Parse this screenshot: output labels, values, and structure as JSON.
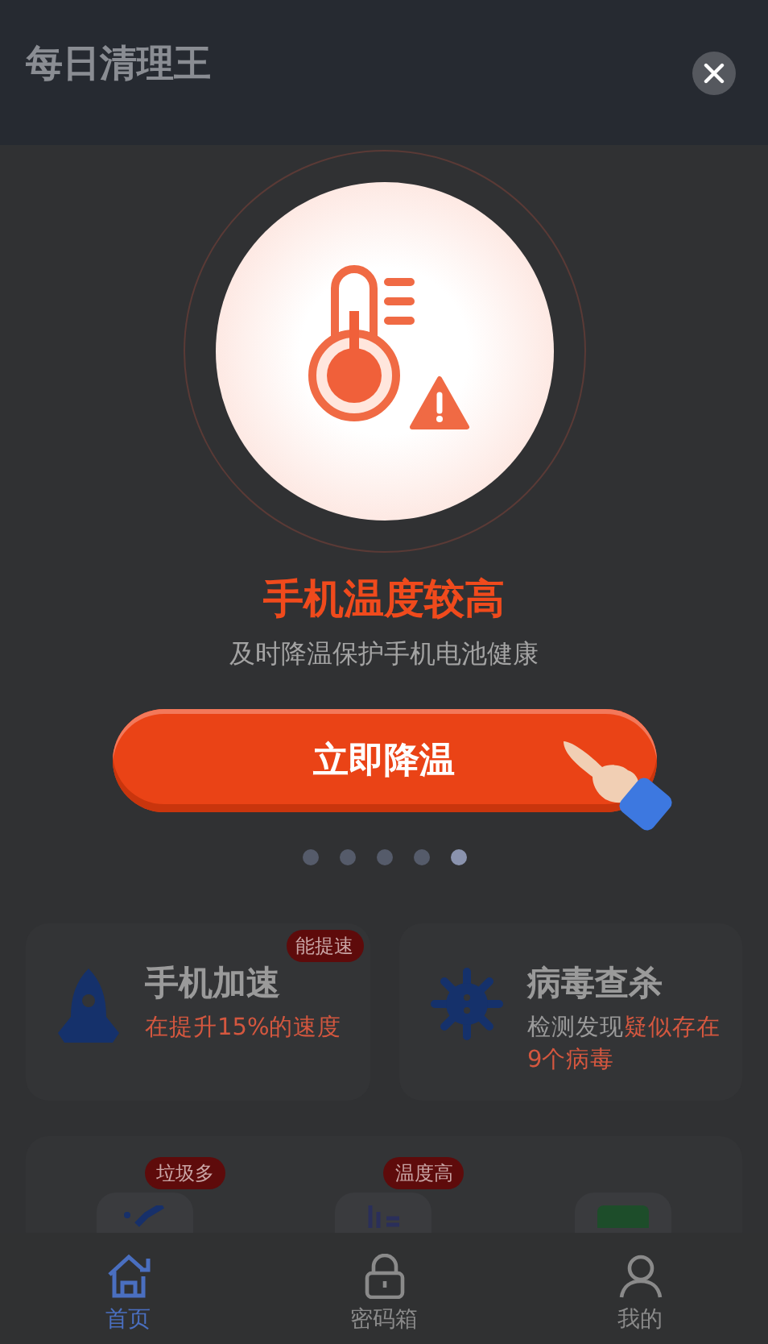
{
  "app": {
    "title": "每日清理王"
  },
  "features": [
    {
      "kind": "rocket",
      "title": "手机加速",
      "badge": "能提速",
      "desc": [
        {
          "text": "在提升15%的速度",
          "highlight": true
        }
      ]
    },
    {
      "kind": "virus",
      "title": "病毒查杀",
      "desc": [
        {
          "text": "检测发现",
          "highlight": false
        },
        {
          "text": "疑似存在9个病毒",
          "highlight": true
        }
      ]
    }
  ],
  "tools": [
    {
      "kind": "clean",
      "badge": "垃圾多"
    },
    {
      "kind": "cool",
      "badge": "温度高"
    },
    {
      "kind": "green"
    }
  ],
  "nav": [
    {
      "label": "首页",
      "selected": true
    },
    {
      "label": "密码箱",
      "selected": false
    },
    {
      "label": "我的",
      "selected": false
    }
  ],
  "popup": {
    "title": "手机温度较高",
    "subtitle": "及时降温保护手机电池健康",
    "button": "立即降温",
    "pages": [
      {
        "selected": false
      },
      {
        "selected": false
      },
      {
        "selected": false
      },
      {
        "selected": false
      },
      {
        "selected": true
      }
    ]
  }
}
